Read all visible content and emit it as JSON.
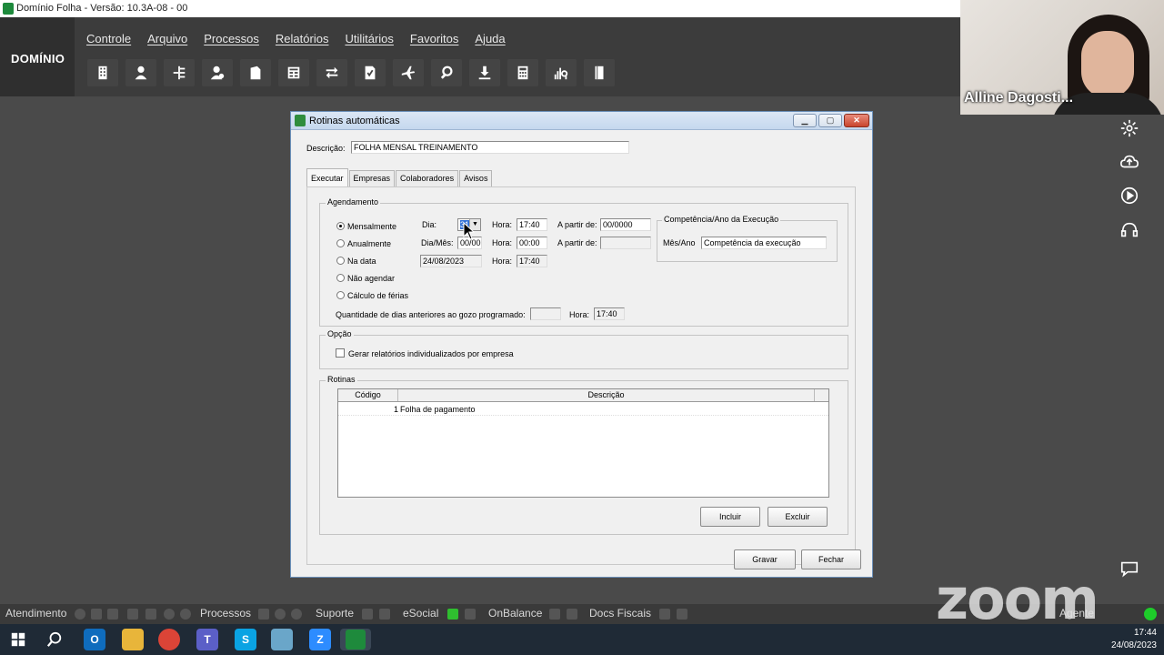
{
  "app": {
    "window_title": "Domínio Folha - Versão: 10.3A-08 - 00",
    "logo": "DOMÍNIO"
  },
  "menu": [
    "Controle",
    "Arquivo",
    "Processos",
    "Relatórios",
    "Utilitários",
    "Favoritos",
    "Ajuda"
  ],
  "toolbar_icons": [
    "building-icon",
    "person-icon",
    "branch-icon",
    "person-money-icon",
    "document-icon",
    "calculator-sheet-icon",
    "transfer-icon",
    "document-check-icon",
    "airplane-icon",
    "search-icon",
    "download-icon",
    "calculator-icon",
    "chart-search-icon",
    "book-icon"
  ],
  "dialog": {
    "title": "Rotinas automáticas",
    "descricao_label": "Descrição:",
    "descricao_value": "FOLHA MENSAL TREINAMENTO",
    "tabs": [
      "Executar",
      "Empresas",
      "Colaboradores",
      "Avisos"
    ],
    "active_tab": "Executar",
    "agendamento": {
      "title": "Agendamento",
      "options": [
        {
          "label": "Mensalmente",
          "selected": true
        },
        {
          "label": "Anualmente",
          "selected": false
        },
        {
          "label": "Na data",
          "selected": false
        },
        {
          "label": "Não agendar",
          "selected": false
        },
        {
          "label": "Cálculo de férias",
          "selected": false
        }
      ],
      "dia_label": "Dia:",
      "dia_value": "31",
      "hora_label": "Hora:",
      "hora1": "17:40",
      "a_partir_label": "A partir de:",
      "a_partir1": "00/0000",
      "dia_mes_label": "Dia/Mês:",
      "dia_mes_value": "00/00",
      "hora2": "00:00",
      "a_partir2": "",
      "na_data_value": "24/08/2023",
      "hora3": "17:40",
      "qtd_dias_label": "Quantidade de dias anteriores ao gozo programado:",
      "qtd_dias_value": "",
      "hora4": "17:40"
    },
    "competencia": {
      "title": "Competência/Ano da Execução",
      "mes_ano_label": "Mês/Ano",
      "mes_ano_value": "Competência da execução"
    },
    "opcao": {
      "title": "Opção",
      "checkbox_label": "Gerar relatórios individualizados por empresa",
      "checked": false
    },
    "rotinas": {
      "title": "Rotinas",
      "columns": [
        "Código",
        "Descrição"
      ],
      "rows": [
        {
          "codigo": "1",
          "descricao": "Folha de pagamento"
        }
      ],
      "incluir": "Incluir",
      "excluir": "Excluir"
    },
    "gravar": "Gravar",
    "fechar": "Fechar"
  },
  "webcam": {
    "participant_name": "Alline Dagosti..."
  },
  "statusbar": {
    "items": [
      "Atendimento",
      "Processos",
      "Suporte",
      "eSocial",
      "OnBalance",
      "Docs Fiscais",
      "Agente"
    ]
  },
  "zoom_watermark": "zoom",
  "taskbar": {
    "time": "17:44",
    "date": "24/08/2023"
  },
  "colors": {
    "accent_green": "#1e8a3c",
    "header_bg": "#3c3c3c",
    "workspace_bg": "#4a4a4a"
  }
}
